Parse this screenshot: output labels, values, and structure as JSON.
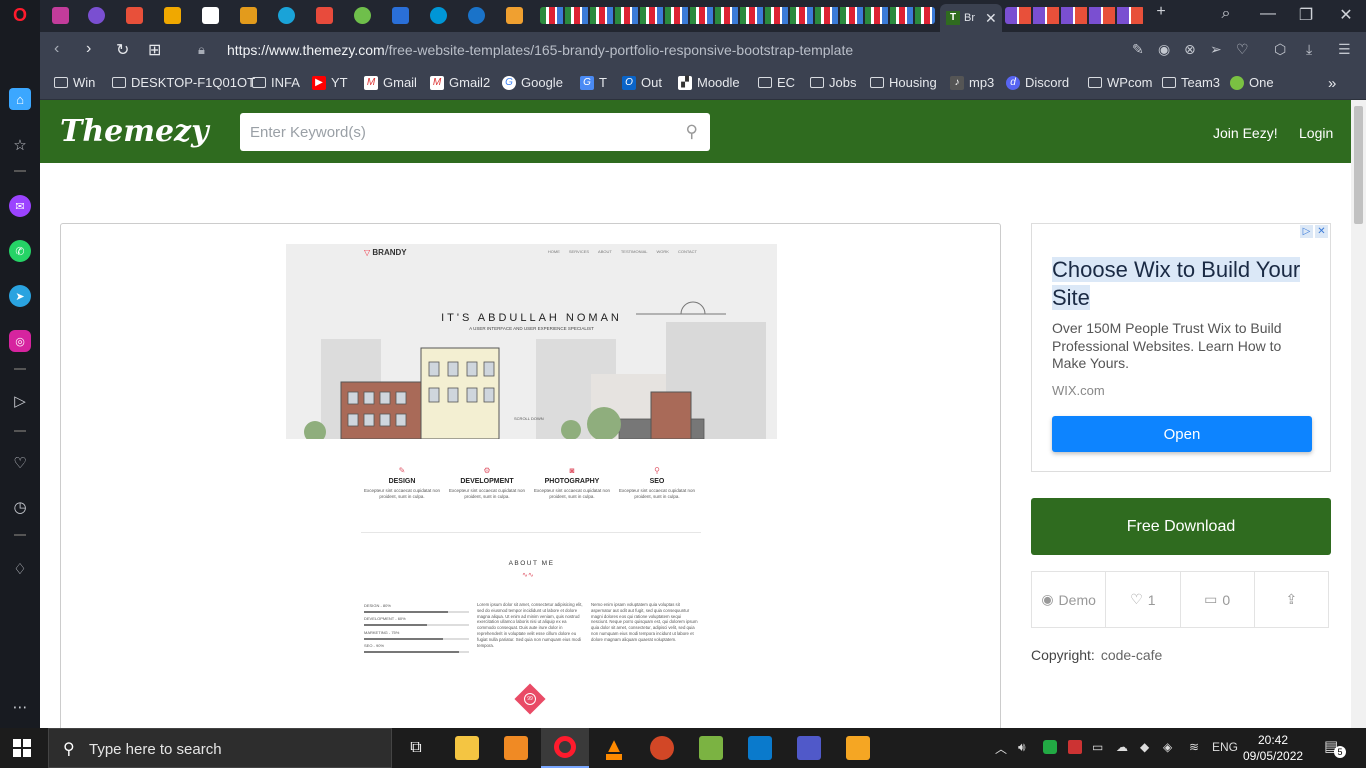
{
  "browser": {
    "active_tab_label": "Br",
    "url_host": "https://www.themezy.com",
    "url_path": "/free-website-templates/165-brandy-portfolio-responsive-bootstrap-template",
    "bookmarks": [
      "Win",
      "DESKTOP-F1Q01OT",
      "INFA",
      "YT",
      "Gmail",
      "Gmail2",
      "Google",
      "T",
      "Out",
      "Moodle",
      "EC",
      "Jobs",
      "Housing",
      "mp3",
      "Discord",
      "WPcom",
      "Team3",
      "One"
    ]
  },
  "site": {
    "logo": "Themezy",
    "search_placeholder": "Enter Keyword(s)",
    "join": "Join Eezy!",
    "login": "Login"
  },
  "preview": {
    "brand": "BRANDY",
    "nav": [
      "HOME",
      "SERVICES",
      "ABOUT",
      "TESTIMONIAL",
      "WORK",
      "CONTACT"
    ],
    "hero_title": "IT'S ABDULLAH NOMAN",
    "hero_subtitle": "A USER INTERFACE AND USER EXPERIENCE SPECIALIST",
    "scroll": "SCROLL DOWN",
    "services": [
      {
        "title": "DESIGN",
        "desc": "Excepteur sint occaecat cupidatat non proident, sunt in culpa."
      },
      {
        "title": "DEVELOPMENT",
        "desc": "Excepteur sint occaecat cupidatat non proident, sunt in culpa."
      },
      {
        "title": "PHOTOGRAPHY",
        "desc": "Excepteur sint occaecat cupidatat non proident, sunt in culpa."
      },
      {
        "title": "SEO",
        "desc": "Excepteur sint occaecat cupidatat non proident, sunt in culpa."
      }
    ],
    "about_title": "ABOUT ME",
    "skills": [
      {
        "label": "DESIGN - 80%",
        "value": 0.8
      },
      {
        "label": "DEVELOPMENT - 60%",
        "value": 0.6
      },
      {
        "label": "MARKETING - 75%",
        "value": 0.75
      },
      {
        "label": "SEO - 90%",
        "value": 0.9
      }
    ],
    "para1": "Lorem ipsum dolor sit amet, consectetur adipisicing elit, sed do eiusmod tempor incididunt ut labore et dolore magna aliqua. Ut enim ad minim veniam, quis nostrud exercitation ullamco laboris nisi ut aliquip ex ea commodo consequat. Duis aute irure dolor in reprehenderit in voluptate velit esse cillum dolore eu fugiat nulla pariatur. Sed quia non numquam eius modi tempora.",
    "para2": "Nemo enim ipsam voluptatem quia voluptas sit aspernatur aut odit aut fugit, sed quia consequuntur magni dolores eos qui ratione voluptatem sequi nesciunt. Neque porro quisquam est, qui dolorem ipsum quia dolor sit amet, consectetur, adipisci velit, sed quia non numquam eius modi tempora incidunt ut labore et dolore magnam aliquam quaerat voluptatem."
  },
  "ad": {
    "headline": "Choose Wix to Build Your Site",
    "body": "Over 150M People Trust Wix to Build Professional Websites. Learn How to Make Yours.",
    "domain": "WIX.com",
    "cta": "Open"
  },
  "sidebar": {
    "download": "Free Download",
    "demo": "Demo",
    "likes": "1",
    "comments": "0",
    "copyright_label": "Copyright:",
    "copyright_value": "code-cafe"
  },
  "taskbar": {
    "search_placeholder": "Type here to search",
    "lang": "ENG",
    "time": "20:42",
    "date": "09/05/2022",
    "notif": "5"
  },
  "colors": {
    "brand_green": "#2f6b1f",
    "ad_blue": "#0d84ff",
    "accent_pink": "#e94b66"
  }
}
